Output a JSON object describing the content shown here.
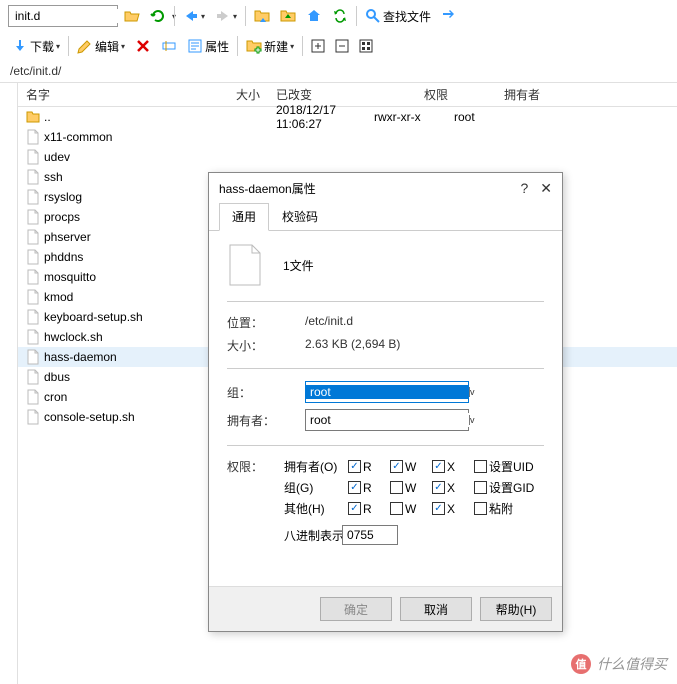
{
  "toolbar": {
    "address": "init.d",
    "download_label": "下载",
    "edit_label": "编辑",
    "properties_label": "属性",
    "new_label": "新建",
    "find_label": "查找文件"
  },
  "pathbar": "/etc/init.d/",
  "list": {
    "headers": {
      "name": "名字",
      "size": "大小",
      "changed": "已改变",
      "perm": "权限",
      "owner": "拥有者"
    },
    "parent": {
      "name": "..",
      "date": "2018/12/17 11:06:27",
      "perm": "rwxr-xr-x",
      "owner": "root"
    },
    "items": [
      {
        "name": "x11-common"
      },
      {
        "name": "udev"
      },
      {
        "name": "ssh"
      },
      {
        "name": "rsyslog"
      },
      {
        "name": "procps"
      },
      {
        "name": "phserver"
      },
      {
        "name": "phddns"
      },
      {
        "name": "mosquitto"
      },
      {
        "name": "kmod"
      },
      {
        "name": "keyboard-setup.sh"
      },
      {
        "name": "hwclock.sh"
      },
      {
        "name": "hass-daemon",
        "selected": true
      },
      {
        "name": "dbus"
      },
      {
        "name": "cron"
      },
      {
        "name": "console-setup.sh"
      }
    ]
  },
  "dialog": {
    "title": "hass-daemon属性",
    "tabs": {
      "general": "通用",
      "checksum": "校验码"
    },
    "file_count": "1文件",
    "location_label": "位置：",
    "location": "/etc/init.d",
    "size_label": "大小：",
    "size": "2.63 KB (2,694 B)",
    "group_label": "组：",
    "group": "root",
    "owner_label": "拥有者：",
    "owner": "root",
    "perm_label": "权限：",
    "perm_owner": "拥有者(O)",
    "perm_group": "组(G)",
    "perm_other": "其他(H)",
    "R": "R",
    "W": "W",
    "X": "X",
    "setuid": "设置UID",
    "setgid": "设置GID",
    "sticky": "粘附",
    "octal_label": "八进制表示",
    "octal": "0755",
    "ok": "确定",
    "cancel": "取消",
    "help": "帮助(H)"
  },
  "watermark": {
    "icon": "值",
    "text": "什么值得买"
  }
}
